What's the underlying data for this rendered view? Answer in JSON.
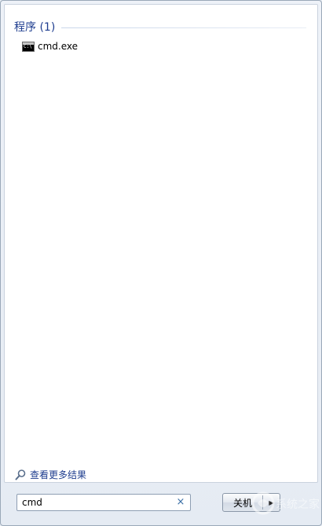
{
  "results": {
    "group_title": "程序 (1)",
    "items": [
      {
        "label": "cmd.exe",
        "icon": "cmd-console-icon"
      }
    ],
    "see_more_label": "查看更多结果"
  },
  "search": {
    "value": "cmd",
    "clear_glyph": "×"
  },
  "shutdown": {
    "label": "关机",
    "arrow_glyph": "▶"
  },
  "watermark": {
    "text": "系统之家"
  },
  "colors": {
    "group_title": "#1e3d8f",
    "link": "#1e3d8f",
    "panel_bg": "#e9eef5",
    "results_bg": "#ffffff"
  }
}
